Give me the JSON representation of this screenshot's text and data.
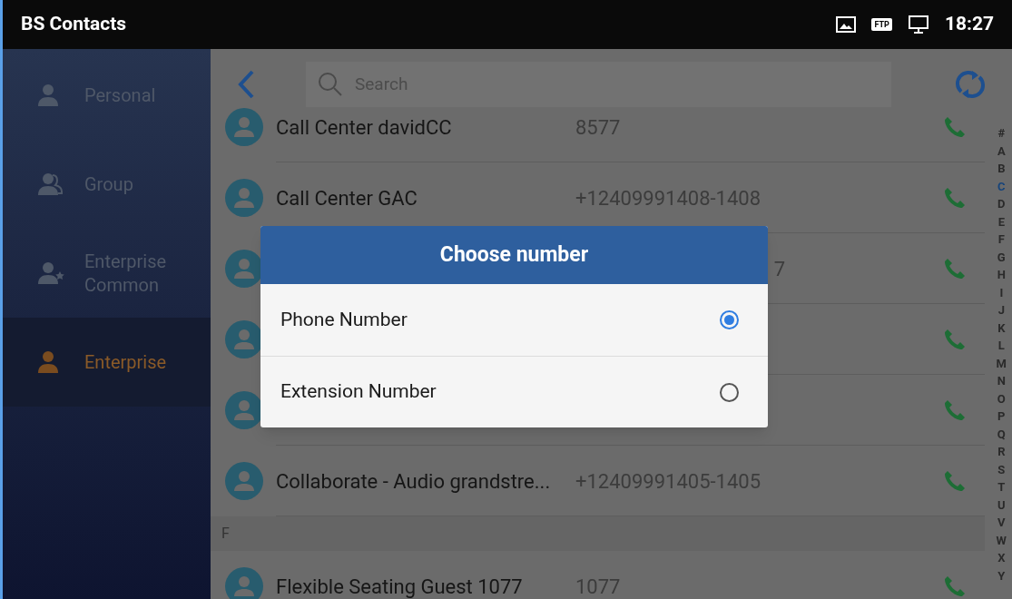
{
  "status_bar": {
    "title": "BS Contacts",
    "ftp_badge": "FTP",
    "time": "18:27"
  },
  "sidebar": {
    "items": [
      {
        "label": "Personal",
        "selected": false
      },
      {
        "label": "Group",
        "selected": false
      },
      {
        "label": "Enterprise Common",
        "selected": false
      },
      {
        "label": "Enterprise",
        "selected": true
      }
    ]
  },
  "search": {
    "placeholder": "Search"
  },
  "contacts": [
    {
      "kind": "contact",
      "name": "Call Center davidCC",
      "number": "8577"
    },
    {
      "kind": "contact",
      "name": "Call Center GAC",
      "number": "+12409991408-1408"
    },
    {
      "kind": "covered",
      "number_tail": "7"
    },
    {
      "kind": "covered"
    },
    {
      "kind": "covered"
    },
    {
      "kind": "contact",
      "name": "Collaborate - Audio grandstre...",
      "number": "+12409991405-1405"
    },
    {
      "kind": "header",
      "name": "F"
    },
    {
      "kind": "contact",
      "name": "Flexible Seating Guest 1077",
      "number": "1077"
    }
  ],
  "index": [
    {
      "letter": "#",
      "selected": false
    },
    {
      "letter": "A",
      "selected": false
    },
    {
      "letter": "B",
      "selected": false
    },
    {
      "letter": "C",
      "selected": true
    },
    {
      "letter": "D",
      "selected": false
    },
    {
      "letter": "E",
      "selected": false
    },
    {
      "letter": "F",
      "selected": false
    },
    {
      "letter": "G",
      "selected": false
    },
    {
      "letter": "H",
      "selected": false
    },
    {
      "letter": "I",
      "selected": false
    },
    {
      "letter": "J",
      "selected": false
    },
    {
      "letter": "K",
      "selected": false
    },
    {
      "letter": "L",
      "selected": false
    },
    {
      "letter": "M",
      "selected": false
    },
    {
      "letter": "N",
      "selected": false
    },
    {
      "letter": "O",
      "selected": false
    },
    {
      "letter": "P",
      "selected": false
    },
    {
      "letter": "Q",
      "selected": false
    },
    {
      "letter": "R",
      "selected": false
    },
    {
      "letter": "S",
      "selected": false
    },
    {
      "letter": "T",
      "selected": false
    },
    {
      "letter": "U",
      "selected": false
    },
    {
      "letter": "V",
      "selected": false
    },
    {
      "letter": "W",
      "selected": false
    },
    {
      "letter": "X",
      "selected": false
    },
    {
      "letter": "Y",
      "selected": false
    }
  ],
  "dialog": {
    "title": "Choose number",
    "options": [
      {
        "label": "Phone Number",
        "selected": true
      },
      {
        "label": "Extension Number",
        "selected": false
      }
    ]
  }
}
